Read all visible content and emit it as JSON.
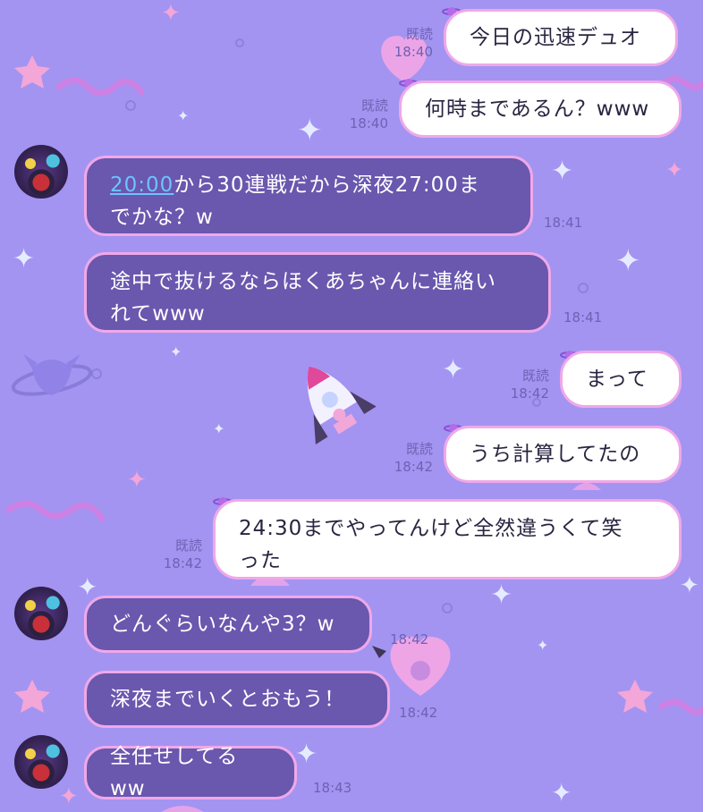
{
  "colors": {
    "background": "#a394f2",
    "outgoing_bubble": "#ffffff",
    "incoming_bubble": "#6a57ae",
    "bubble_border": "#f0a8e8",
    "link": "#6cc3ff"
  },
  "messages": {
    "m1": {
      "text": "今日の迅速デュオ",
      "read": "既読",
      "time": "18:40"
    },
    "m2": {
      "text": "何時まであるん？www",
      "read": "既読",
      "time": "18:40"
    },
    "m3": {
      "link_text": "20:00",
      "text_line1": "から30連戦だから深夜27:00ま",
      "text_line2": "でかな？w",
      "time": "18:41"
    },
    "m4": {
      "text_line1": "途中で抜けるならほくあちゃんに連絡い",
      "text_line2": "れてwww",
      "time": "18:41"
    },
    "m5": {
      "text": "まって",
      "read": "既読",
      "time": "18:42"
    },
    "m6": {
      "text": "うち計算してたの",
      "read": "既読",
      "time": "18:42"
    },
    "m7": {
      "text_line1": "24:30までやってんけど全然違うくて笑",
      "text_line2": "った",
      "read": "既読",
      "time": "18:42"
    },
    "m8": {
      "text": "どんぐらいなんや3？w",
      "time": "18:42"
    },
    "m9": {
      "text": "深夜までいくとおもう！",
      "time": "18:42"
    },
    "m10": {
      "text": "全任せしてるww",
      "time": "18:43"
    }
  },
  "icons": {
    "avatar": "friend-avatar",
    "bubble_deco": "planet-icon",
    "background": [
      "sparkle-icon",
      "rocket-icon",
      "heart-skull-icon",
      "star-face-icon",
      "ringed-planet-icon"
    ]
  }
}
